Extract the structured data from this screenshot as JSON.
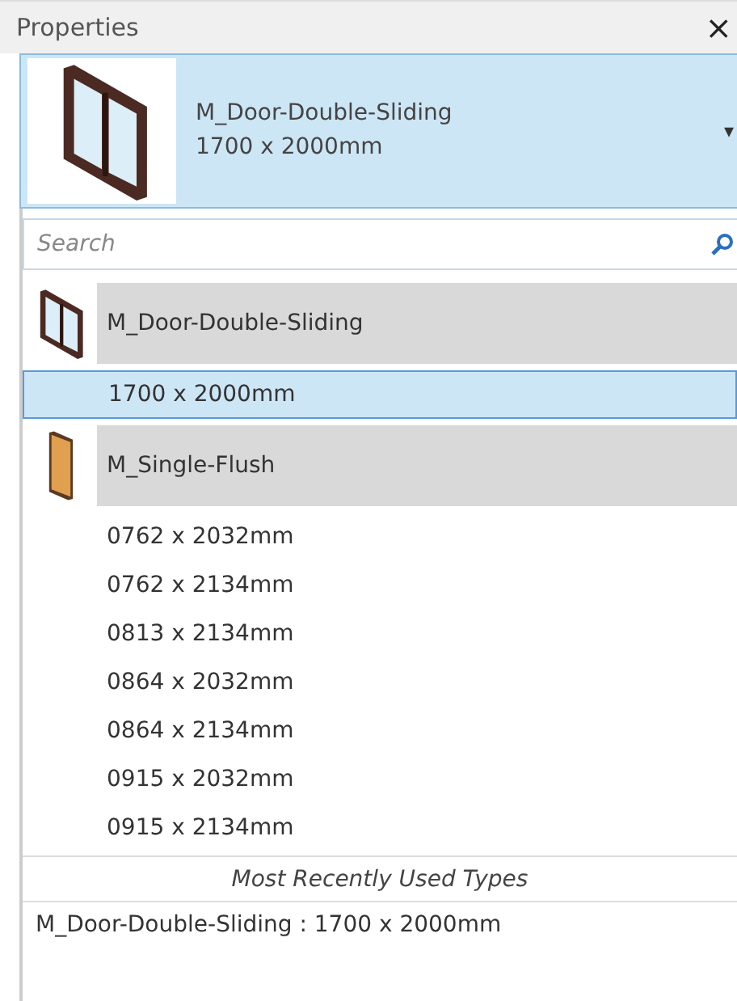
{
  "panel": {
    "title": "Properties",
    "close": "×"
  },
  "header": {
    "family": "M_Door-Double-Sliding",
    "type": "1700 x 2000mm",
    "caret": "▾"
  },
  "search": {
    "placeholder": "Search"
  },
  "items": [
    {
      "kind": "family",
      "label": "M_Door-Double-Sliding",
      "selected": false
    },
    {
      "kind": "type",
      "label": "1700 x 2000mm",
      "selected": true
    },
    {
      "kind": "family",
      "label": "M_Single-Flush",
      "selected": false
    },
    {
      "kind": "type",
      "label": "0762 x 2032mm",
      "selected": false
    },
    {
      "kind": "type",
      "label": "0762 x 2134mm",
      "selected": false
    },
    {
      "kind": "type",
      "label": "0813 x 2134mm",
      "selected": false
    },
    {
      "kind": "type",
      "label": "0864 x 2032mm",
      "selected": false
    },
    {
      "kind": "type",
      "label": "0864 x 2134mm",
      "selected": false
    },
    {
      "kind": "type",
      "label": "0915 x 2032mm",
      "selected": false
    },
    {
      "kind": "type",
      "label": "0915 x 2134mm",
      "selected": false
    }
  ],
  "recent": {
    "heading": "Most Recently Used Types",
    "items": [
      "M_Door-Double-Sliding : 1700 x 2000mm"
    ]
  }
}
